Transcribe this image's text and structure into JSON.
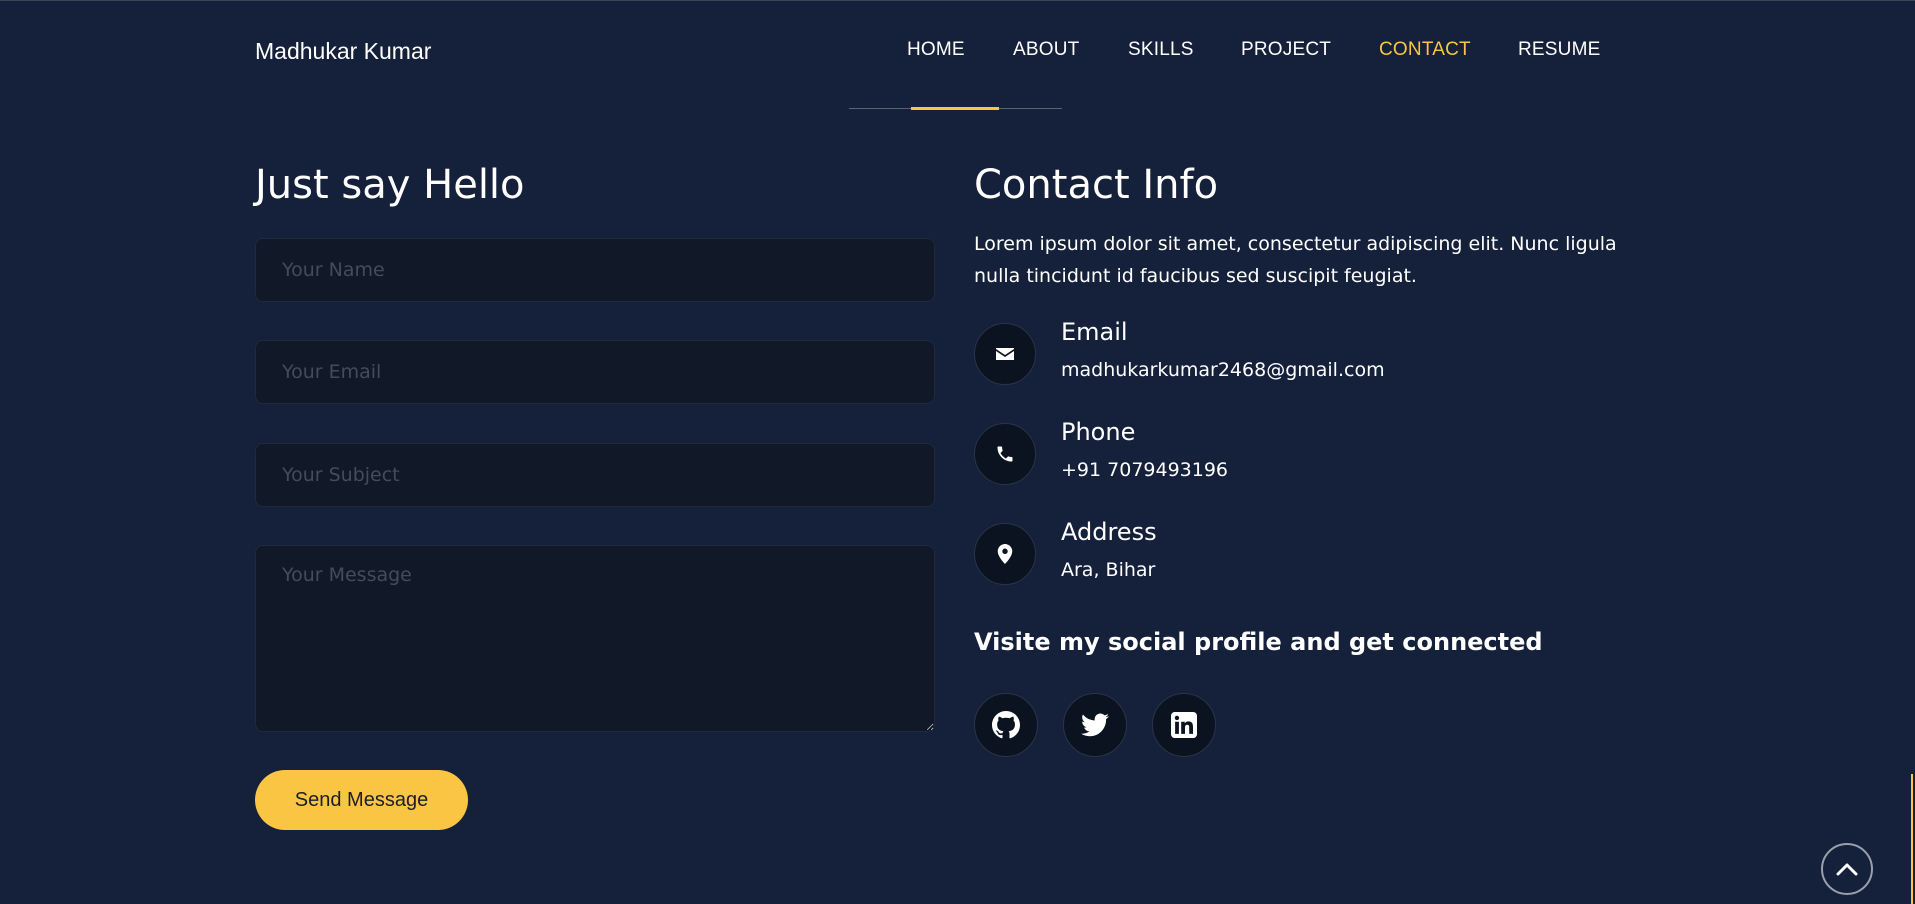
{
  "brand": "Madhukar Kumar",
  "nav": {
    "items": [
      "HOME",
      "ABOUT",
      "SKILLS",
      "PROJECT",
      "CONTACT",
      "RESUME"
    ],
    "active": "CONTACT"
  },
  "form": {
    "title": "Just say Hello",
    "name_placeholder": "Your Name",
    "email_placeholder": "Your Email",
    "subject_placeholder": "Your Subject",
    "message_placeholder": "Your Message",
    "submit_label": "Send Message"
  },
  "contact": {
    "title": "Contact Info",
    "description": "Lorem ipsum dolor sit amet, consectetur adipiscing elit. Nunc ligula nulla tincidunt id faucibus sed suscipit feugiat.",
    "items": [
      {
        "icon": "envelope-icon",
        "label": "Email",
        "value": "madhukarkumar2468@gmail.com"
      },
      {
        "icon": "phone-icon",
        "label": "Phone",
        "value": "+91 7079493196"
      },
      {
        "icon": "map-marker-icon",
        "label": "Address",
        "value": "Ara, Bihar"
      }
    ],
    "social_heading": "Visite my social profile and get connected",
    "social": [
      {
        "icon": "github-icon",
        "name": "GitHub"
      },
      {
        "icon": "twitter-icon",
        "name": "Twitter"
      },
      {
        "icon": "linkedin-icon",
        "name": "LinkedIn"
      }
    ]
  },
  "colors": {
    "background": "#15203a",
    "accent": "#f7c744",
    "button": "#fbc544",
    "field_background": "#111827",
    "icon_circle": "#0b1220"
  },
  "scroll_top_icon": "chevron-up-icon"
}
